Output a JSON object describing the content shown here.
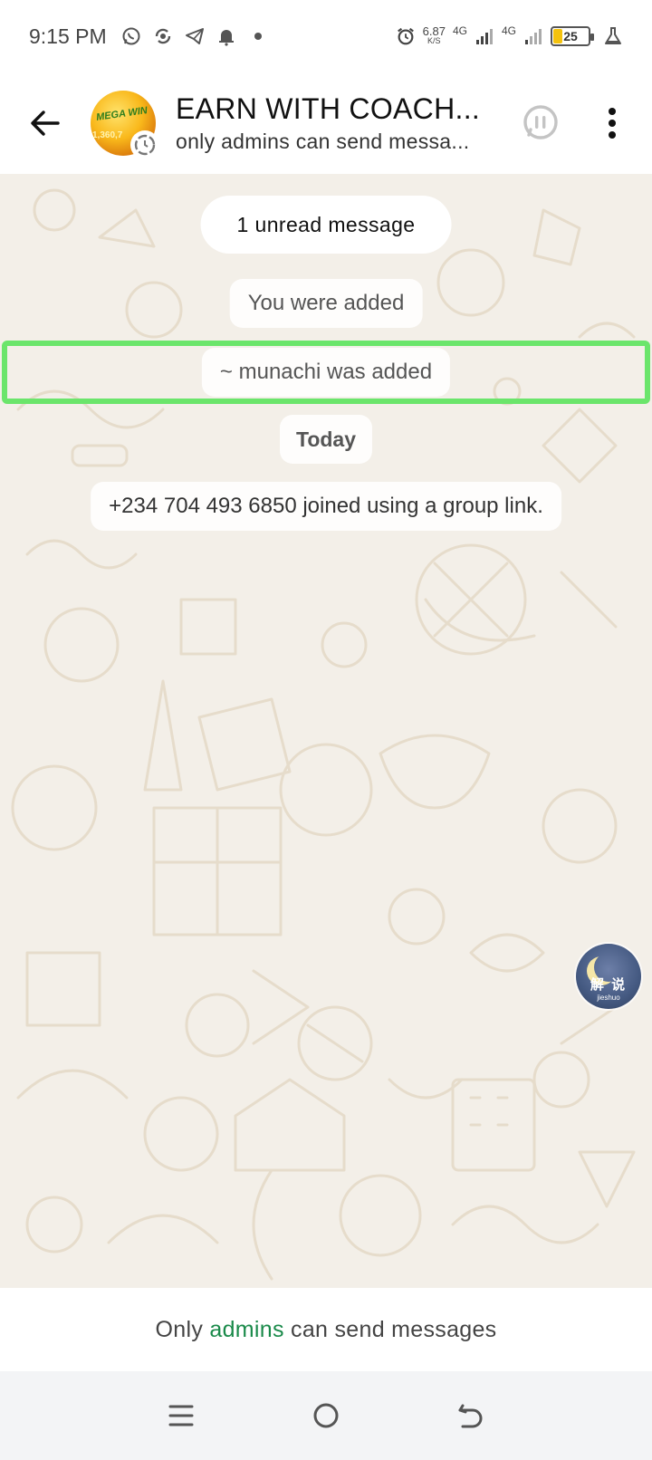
{
  "status_bar": {
    "time": "9:15 PM",
    "net_speed_value": "6.87",
    "net_speed_unit": "K/S",
    "net_type_1": "4G",
    "net_type_2": "4G",
    "battery_level": "25",
    "left_icons": [
      "whatsapp-icon",
      "sync-icon",
      "telegram-icon",
      "bell-icon",
      "dot-icon"
    ],
    "right_icons": [
      "alarm-icon",
      "signal-icon",
      "signal-icon",
      "battery-icon",
      "flask-icon"
    ]
  },
  "header": {
    "title": "EARN WITH COACH...",
    "subtitle": "only admins can send messa...",
    "avatar_text": "MEGA WIN",
    "avatar_number": "1,360,7"
  },
  "chat": {
    "unread_label": "1 unread message",
    "system_messages": [
      "You were added",
      "~ munachi was added"
    ],
    "date_label": "Today",
    "joined_message": "+234 704 493 6850 joined using a group link."
  },
  "floating_widget": {
    "zh_label": "解 说",
    "en_label": "jieshuo"
  },
  "footer": {
    "prefix": "Only ",
    "accent_word": "admins",
    "suffix": " can send messages"
  },
  "colors": {
    "accent_green": "#1a8a4a",
    "highlight_green": "#6be56b",
    "chat_background": "#f3efe8"
  }
}
